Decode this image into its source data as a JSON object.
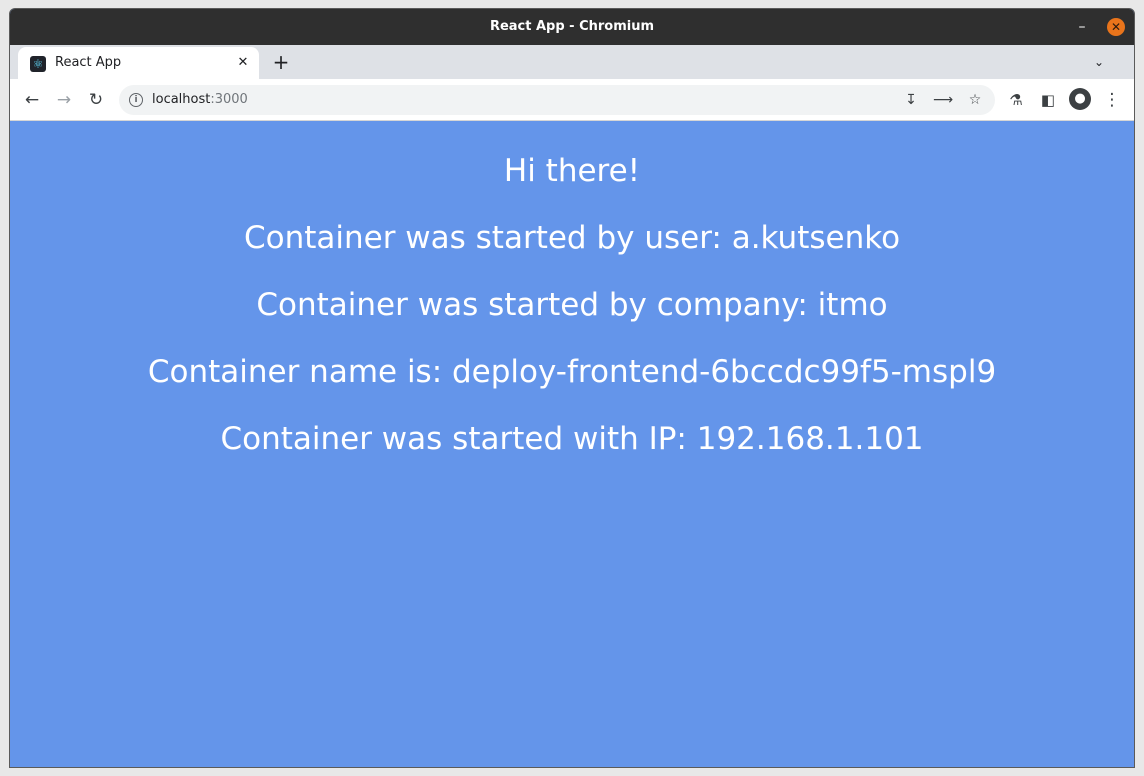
{
  "window": {
    "title": "React App - Chromium"
  },
  "tab": {
    "title": "React App"
  },
  "address_bar": {
    "host": "localhost",
    "port": ":3000"
  },
  "icons": {
    "back": "arrow-left",
    "forward": "arrow-right",
    "reload": "reload",
    "site_info": "info-circle",
    "install": "install-app",
    "share": "share",
    "bookmark": "star",
    "labs": "flask",
    "side_panel": "side-panel",
    "profile": "account-circle",
    "menu": "vertical-dots"
  },
  "page": {
    "lines": [
      "Hi there!",
      "Container was started by user: a.kutsenko",
      "Container was started by company: itmo",
      "Container name is: deploy-frontend-6bccdc99f5-mspl9",
      "Container was started with IP: 192.168.1.101"
    ],
    "background_color": "#6495ea",
    "text_color": "#ffffff"
  }
}
